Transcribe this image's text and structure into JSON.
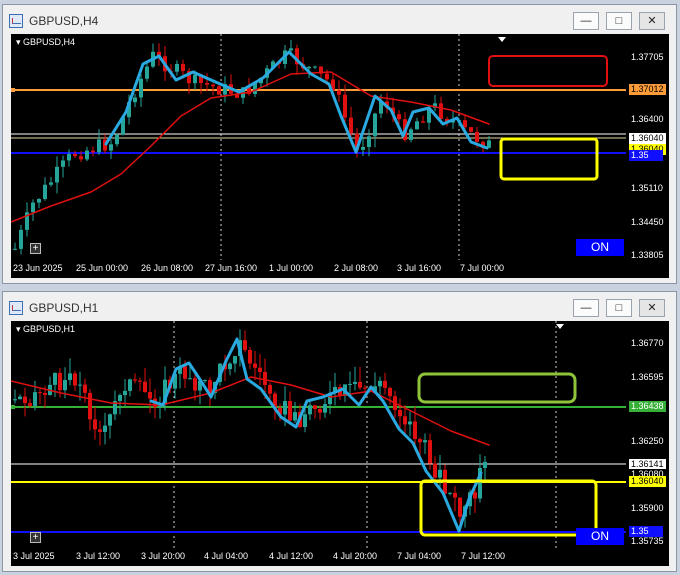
{
  "windows": [
    {
      "title": "GBPUSD,H4",
      "chart_label": "GBPUSD,H4",
      "on_button": "ON",
      "plus": "+",
      "price_axis": [
        "1.37705",
        "1.36400",
        "1.35110",
        "1.34450",
        "1.33805"
      ],
      "price_labels": {
        "orange": "1.37012",
        "white": "1.36040",
        "blue": "1.35",
        "yellow_line": "1.36040"
      },
      "time_axis": [
        "23 Jun 2025",
        "25 Jun 00:00",
        "26 Jun 08:00",
        "27 Jun 16:00",
        "1 Jul 00:00",
        "2 Jul 08:00",
        "3 Jul 16:00",
        "7 Jul 00:00"
      ],
      "colors": {
        "orange_line": "#ff9c3a",
        "blue_line": "#1010ff",
        "yellow_box": "#ffff00",
        "red_box": "#e01010",
        "ma": "#e01010",
        "trend": "#29a9e0"
      }
    },
    {
      "title": "GBPUSD,H1",
      "chart_label": "GBPUSD,H1",
      "on_button": "ON",
      "plus": "+",
      "price_axis": [
        "1.36770",
        "1.36595",
        "1.36250",
        "1.35900",
        "1.35735"
      ],
      "price_labels": {
        "green": "1.36438",
        "white": "1.36141",
        "yellow": "1.36040",
        "partial": "1.36080",
        "blue": "1.35"
      },
      "time_axis": [
        "3 Jul 2025",
        "3 Jul 12:00",
        "3 Jul 20:00",
        "4 Jul 04:00",
        "4 Jul 12:00",
        "4 Jul 20:00",
        "7 Jul 04:00",
        "7 Jul 12:00"
      ],
      "colors": {
        "green_line": "#36b036",
        "green_box": "#8fc43a",
        "yellow_box": "#ffff00",
        "blue_line": "#1010ff",
        "ma": "#e01010",
        "trend": "#29a9e0"
      }
    }
  ]
}
